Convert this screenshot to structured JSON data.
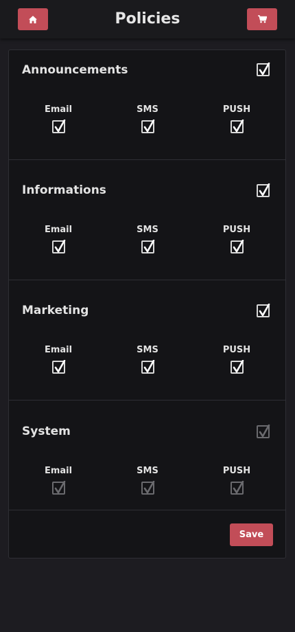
{
  "header": {
    "title": "Policies",
    "home_icon": "home-icon",
    "cart_icon": "cart-icon"
  },
  "sections": [
    {
      "title": "Announcements",
      "enabled": true,
      "all_checked": true,
      "channels": [
        {
          "label": "Email",
          "checked": true
        },
        {
          "label": "SMS",
          "checked": true
        },
        {
          "label": "PUSH",
          "checked": true
        }
      ]
    },
    {
      "title": "Informations",
      "enabled": true,
      "all_checked": true,
      "channels": [
        {
          "label": "Email",
          "checked": true
        },
        {
          "label": "SMS",
          "checked": true
        },
        {
          "label": "PUSH",
          "checked": true
        }
      ]
    },
    {
      "title": "Marketing",
      "enabled": true,
      "all_checked": true,
      "channels": [
        {
          "label": "Email",
          "checked": true
        },
        {
          "label": "SMS",
          "checked": true
        },
        {
          "label": "PUSH",
          "checked": true
        }
      ]
    },
    {
      "title": "System",
      "enabled": false,
      "all_checked": true,
      "channels": [
        {
          "label": "Email",
          "checked": true
        },
        {
          "label": "SMS",
          "checked": true
        },
        {
          "label": "PUSH",
          "checked": true
        }
      ]
    }
  ],
  "footer": {
    "save_label": "Save"
  },
  "colors": {
    "accent": "#c24d58",
    "background": "#1d1c21",
    "panel": "#141417"
  }
}
